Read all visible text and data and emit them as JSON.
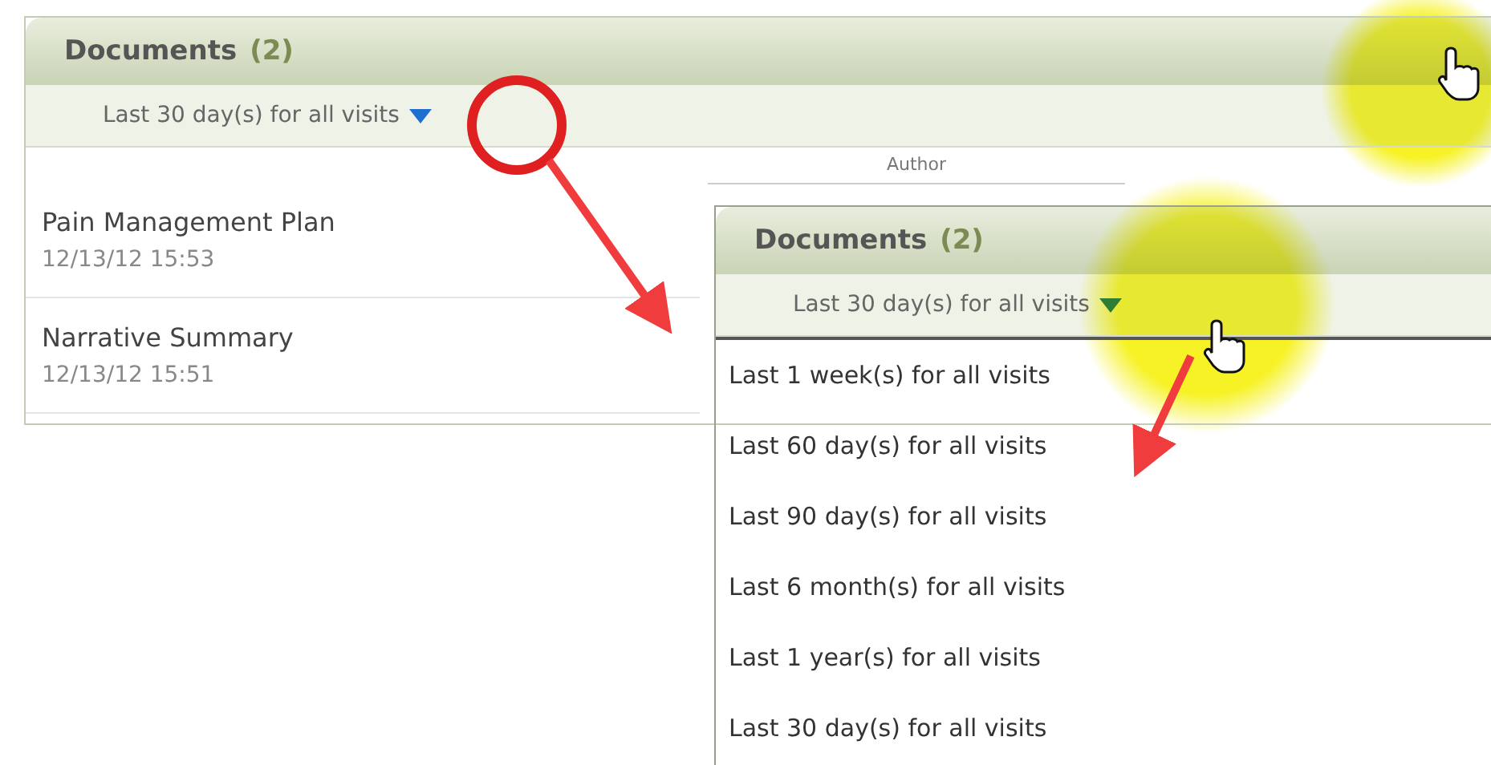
{
  "panels": [
    {
      "title": "Documents",
      "count": "(2)",
      "filter": {
        "label": "Last 30 day(s) for all visits",
        "expanded": false
      },
      "columns": [
        "Author"
      ],
      "rows": [
        {
          "title": "Pain Management Plan",
          "date": "12/13/12 15:53"
        },
        {
          "title": "Narrative Summary",
          "date": "12/13/12 15:51"
        }
      ]
    },
    {
      "title": "Documents",
      "count": "(2)",
      "filter": {
        "label": "Last 30 day(s) for all visits",
        "expanded": true
      },
      "menu": [
        "Last 1 week(s) for all visits",
        "Last 60 day(s) for all visits",
        "Last 90 day(s) for all visits",
        "Last 6 month(s) for all visits",
        "Last 1 year(s) for all visits",
        "Last 30 day(s) for all visits"
      ]
    }
  ]
}
